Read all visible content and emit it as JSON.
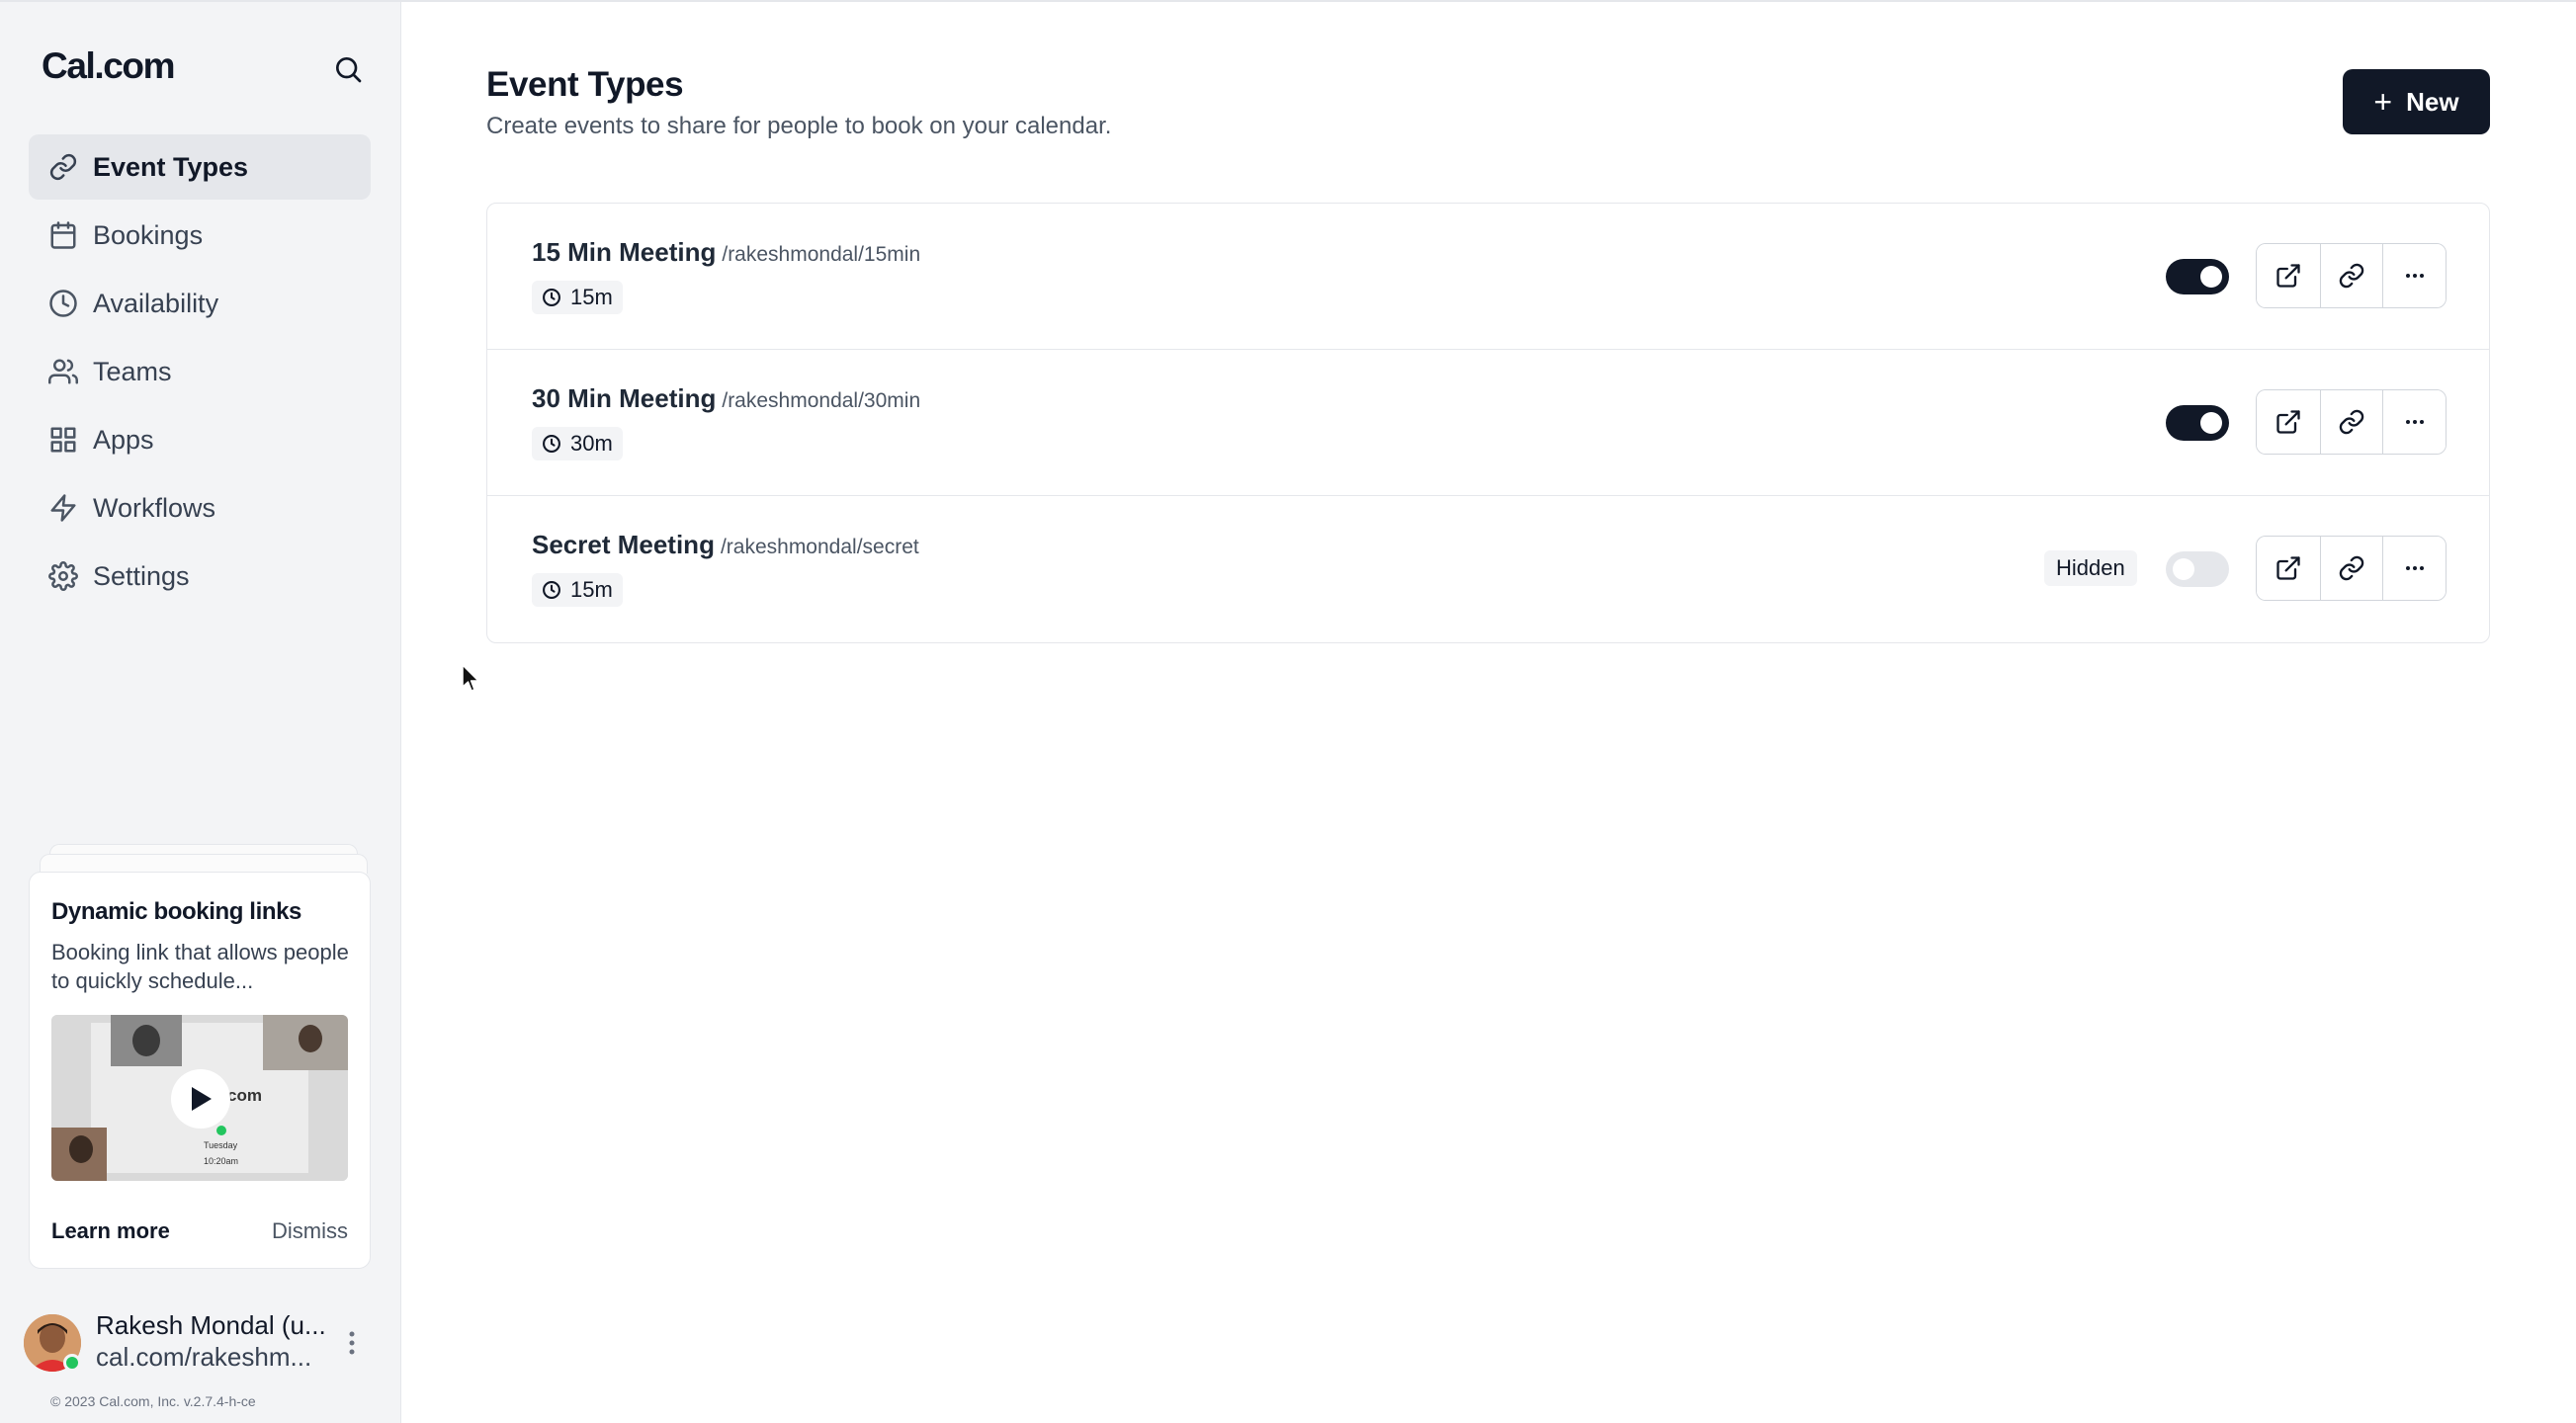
{
  "app": {
    "brand": "Cal.com"
  },
  "sidebar": {
    "items": [
      {
        "label": "Event Types",
        "icon": "link-icon",
        "active": true
      },
      {
        "label": "Bookings",
        "icon": "calendar-icon",
        "active": false
      },
      {
        "label": "Availability",
        "icon": "clock-icon",
        "active": false
      },
      {
        "label": "Teams",
        "icon": "users-icon",
        "active": false
      },
      {
        "label": "Apps",
        "icon": "grid-icon",
        "active": false
      },
      {
        "label": "Workflows",
        "icon": "zap-icon",
        "active": false
      },
      {
        "label": "Settings",
        "icon": "gear-icon",
        "active": false
      }
    ],
    "promo": {
      "title": "Dynamic booking links",
      "description": "Booking link that allows people to quickly schedule...",
      "video_word": "com",
      "learn_more": "Learn more",
      "dismiss": "Dismiss"
    },
    "user": {
      "name": "Rakesh Mondal (u...",
      "link": "cal.com/rakeshm..."
    },
    "copyright": "© 2023 Cal.com, Inc. v.2.7.4-h-ce"
  },
  "header": {
    "title": "Event Types",
    "subtitle": "Create events to share for people to book on your calendar.",
    "new_button": "New"
  },
  "events": [
    {
      "title": "15 Min Meeting",
      "slug": "/rakeshmondal/15min",
      "duration": "15m",
      "enabled": true,
      "hidden_label": ""
    },
    {
      "title": "30 Min Meeting",
      "slug": "/rakeshmondal/30min",
      "duration": "30m",
      "enabled": true,
      "hidden_label": ""
    },
    {
      "title": "Secret Meeting",
      "slug": "/rakeshmondal/secret",
      "duration": "15m",
      "enabled": false,
      "hidden_label": "Hidden"
    }
  ],
  "colors": {
    "primary": "#111827",
    "sidebar_bg": "#f3f4f6",
    "border": "#e5e7eb",
    "online": "#22c55e"
  }
}
